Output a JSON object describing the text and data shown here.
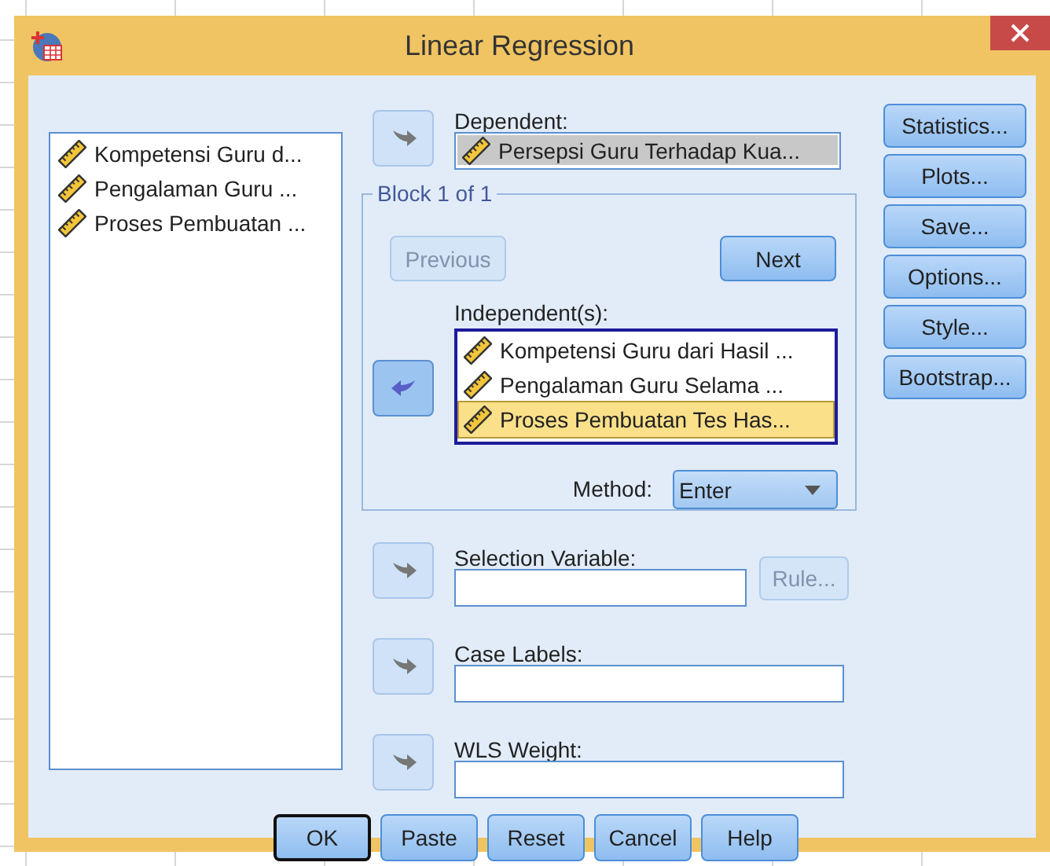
{
  "window": {
    "title": "Linear Regression"
  },
  "variables": [
    {
      "label": "Kompetensi Guru d..."
    },
    {
      "label": "Pengalaman Guru ..."
    },
    {
      "label": "Proses Pembuatan ..."
    }
  ],
  "dependent": {
    "arrow": {
      "kind": "right",
      "disabled": true
    },
    "label": "Dependent:",
    "value": "Persepsi Guru Terhadap Kua..."
  },
  "block": {
    "title": "Block 1 of 1",
    "previous": {
      "label": "Previous",
      "disabled": true
    },
    "next": {
      "label": "Next",
      "disabled": false
    },
    "arrow": {
      "kind": "left",
      "disabled": false
    },
    "independents_label": "Independent(s):",
    "independents": [
      {
        "label": "Kompetensi Guru dari Hasil ...",
        "selected": false
      },
      {
        "label": "Pengalaman Guru Selama ...",
        "selected": false
      },
      {
        "label": "Proses Pembuatan Tes Has...",
        "selected": true
      }
    ],
    "method_label": "Method:",
    "method": "Enter"
  },
  "selection_variable": {
    "arrow": {
      "kind": "right",
      "disabled": true
    },
    "label": "Selection Variable:",
    "rule": {
      "label": "Rule...",
      "disabled": true
    }
  },
  "case_labels": {
    "arrow": {
      "kind": "right",
      "disabled": true
    },
    "label": "Case Labels:"
  },
  "wls_weight": {
    "arrow": {
      "kind": "right",
      "disabled": true
    },
    "label": "WLS Weight:"
  },
  "side_buttons": [
    "Statistics...",
    "Plots...",
    "Save...",
    "Options...",
    "Style...",
    "Bootstrap..."
  ],
  "bottom_buttons": [
    {
      "label": "OK",
      "default": true
    },
    {
      "label": "Paste",
      "default": false
    },
    {
      "label": "Reset",
      "default": false
    },
    {
      "label": "Cancel",
      "default": false
    },
    {
      "label": "Help",
      "default": false
    }
  ]
}
